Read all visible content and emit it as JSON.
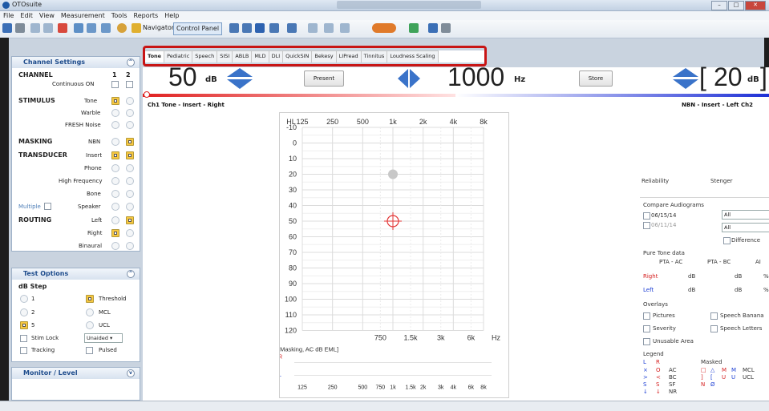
{
  "window": {
    "title": "OTOsuite"
  },
  "menu": [
    "File",
    "Edit",
    "View",
    "Measurement",
    "Tools",
    "Reports",
    "Help"
  ],
  "toolbar": {
    "navigator": "Navigator",
    "control_panel": "Control Panel"
  },
  "channel_settings": {
    "header": "Channel Settings",
    "channel_label": "CHANNEL",
    "ch1": "1",
    "ch2": "2",
    "continuous_on": "Continuous ON",
    "stimulus_label": "STIMULUS",
    "tone": "Tone",
    "warble": "Warble",
    "fresh_noise": "FRESH Noise",
    "masking_label": "MASKING",
    "nbn": "NBN",
    "transducer_label": "TRANSDUCER",
    "insert": "Insert",
    "phone": "Phone",
    "high_frequency": "High Frequency",
    "bone": "Bone",
    "multiple": "Multiple",
    "speaker": "Speaker",
    "routing_label": "ROUTING",
    "left": "Left",
    "right": "Right",
    "binaural": "Binaural"
  },
  "test_options": {
    "header": "Test Options",
    "db_step": "dB Step",
    "s1": "1",
    "s2": "2",
    "s5": "5",
    "threshold": "Threshold",
    "mcl": "MCL",
    "ucl": "UCL",
    "stim_lock": "Stim Lock",
    "unaided": "Unaided",
    "tracking": "Tracking",
    "pulsed": "Pulsed"
  },
  "monitor": {
    "header": "Monitor / Level"
  },
  "tabs": [
    "Tone",
    "Pediatric",
    "Speech",
    "SISI",
    "ABLB",
    "MLD",
    "DLI",
    "QuickSIN",
    "Bekesy",
    "LIPread",
    "Tinnitus",
    "Loudness Scaling"
  ],
  "main": {
    "ch1_level": "50",
    "ch1_unit": "dB",
    "present": "Present",
    "frequency": "1000",
    "freq_unit": "Hz",
    "store": "Store",
    "ch2_level": "20",
    "ch2_unit": "dB",
    "ch1_label": "Ch1  Tone - Insert - Right",
    "ch2_label": "NBN - Insert - Left  Ch2"
  },
  "audiogram": {
    "hl": "HL",
    "top_freqs": [
      "125",
      "250",
      "500",
      "1k",
      "2k",
      "4k",
      "8k"
    ],
    "db_levels": [
      "-10",
      "0",
      "10",
      "20",
      "30",
      "40",
      "50",
      "60",
      "70",
      "80",
      "90",
      "100",
      "110",
      "120"
    ],
    "bottom_freqs": [
      "750",
      "1.5k",
      "3k",
      "6k"
    ],
    "hz": "Hz",
    "masking_label": "[Masking, AC dB EML]",
    "r": "R",
    "l": "L",
    "mask_freqs": [
      "125",
      "250",
      "500",
      "750",
      "1k",
      "1.5k",
      "2k",
      "3k",
      "4k",
      "6k",
      "8k"
    ],
    "points": [
      {
        "freq_hz": 1000,
        "db": 20,
        "kind": "gray"
      },
      {
        "freq_hz": 1000,
        "db": 50,
        "kind": "target"
      }
    ]
  },
  "right_panel": {
    "reliability": "Reliability",
    "stenger": "Stenger",
    "compare": "Compare Audiograms",
    "date1": "06/15/14",
    "date2": "06/11/14",
    "all": "All",
    "difference": "Difference",
    "pure_tone": "Pure Tone data",
    "pta_ac": "PTA - AC",
    "pta_bc": "PTA - BC",
    "ai": "AI",
    "right": "Right",
    "left": "Left",
    "db": "dB",
    "pct": "%",
    "overlays": "Overlays",
    "pictures": "Pictures",
    "speech_banana": "Speech Banana",
    "severity": "Severity",
    "speech_letters": "Speech Letters",
    "unusable": "Unusable Area",
    "legend": "Legend",
    "masked": "Masked",
    "legend_rows": [
      [
        "×",
        "O",
        "AC",
        "□",
        "△",
        "M",
        "M",
        "MCL"
      ],
      [
        ">",
        "<",
        "BC",
        "]",
        "[",
        "U",
        "U",
        "UCL"
      ],
      [
        "S",
        "S",
        "SF",
        "N",
        "Ø",
        "",
        "",
        ""
      ],
      [
        "↓",
        "↓",
        "NR",
        "",
        "",
        "",
        "",
        ""
      ]
    ],
    "legend_left": "L",
    "legend_right": "R"
  }
}
